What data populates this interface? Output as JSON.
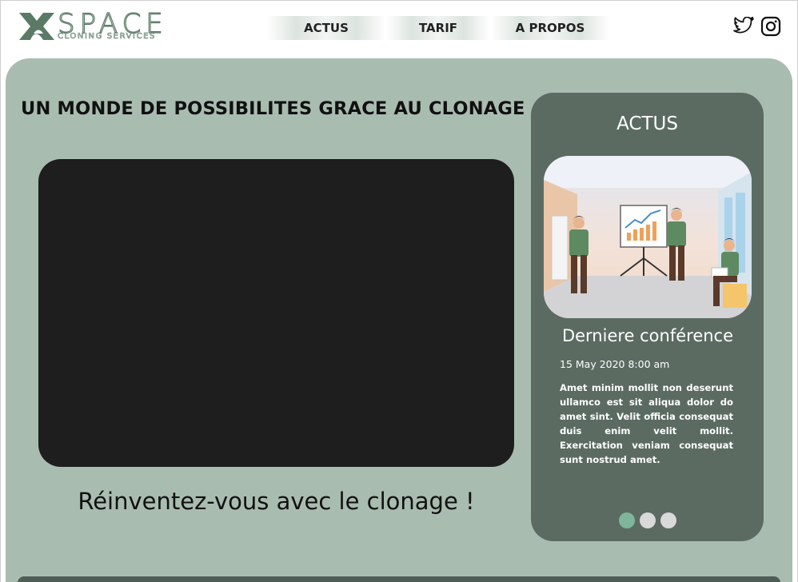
{
  "header": {
    "logo_word": "SPACE",
    "logo_sub": "CLONING SERVICES",
    "nav": [
      {
        "label": "ACTUS"
      },
      {
        "label": "TARIF"
      },
      {
        "label": "A PROPOS"
      }
    ],
    "social": [
      {
        "icon": "twitter-icon"
      },
      {
        "icon": "instagram-icon"
      }
    ]
  },
  "main": {
    "headline": "UN MONDE DE POSSIBILITES GRACE AU CLONAGE",
    "tagline": "Réinventez-vous avec le clonage !"
  },
  "news": {
    "title": "ACTUS",
    "heading": "Derniere conférence",
    "date": "15 May 2020 8:00 am",
    "body": "Amet minim mollit non deserunt ullamco est sit aliqua dolor do amet sint. Velit officia consequat duis enim velit mollit. Exercitation veniam consequat sunt nostrud amet.",
    "slide_count": 3,
    "active_slide": 1
  },
  "colors": {
    "brand_green": "#5a7a66",
    "panel": "#a9bcb0",
    "card": "#5b6b62",
    "video": "#1e1e1e",
    "dot_active": "#7fb59a",
    "dot_inactive": "#d9d9d9"
  }
}
